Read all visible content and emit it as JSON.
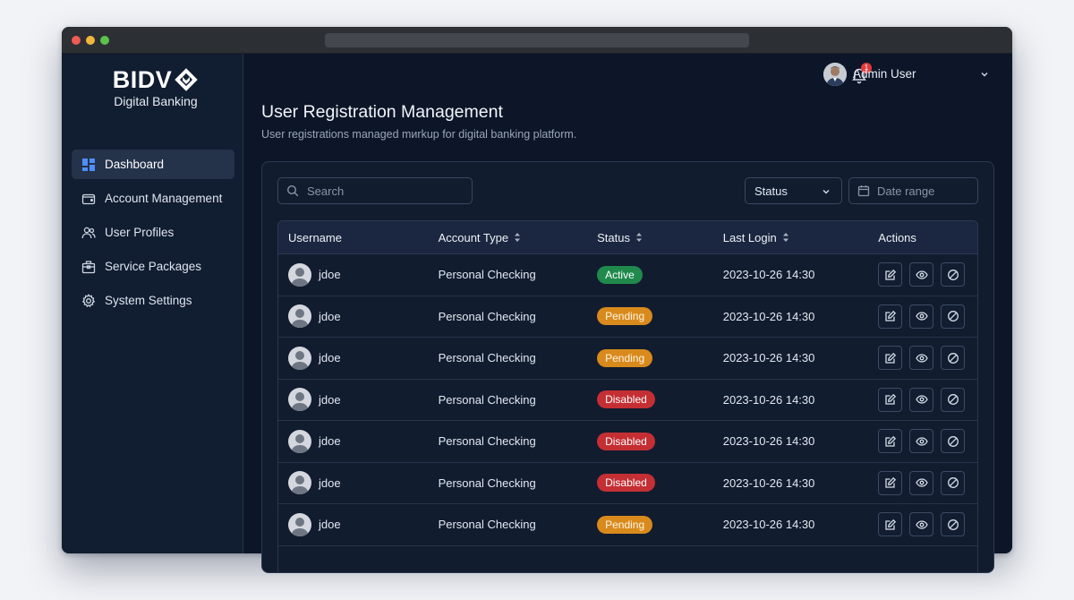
{
  "brand": {
    "name": "BIDV",
    "subtitle": "Digital Banking"
  },
  "sidebar": {
    "items": [
      {
        "label": "Dashboard",
        "icon": "dashboard-grid-icon",
        "active": true
      },
      {
        "label": "Account Management",
        "icon": "wallet-icon",
        "active": false
      },
      {
        "label": "User Profiles",
        "icon": "users-icon",
        "active": false
      },
      {
        "label": "Service Packages",
        "icon": "package-icon",
        "active": false
      },
      {
        "label": "System Settings",
        "icon": "gear-icon",
        "active": false
      }
    ]
  },
  "header": {
    "notification_count": "1",
    "user_name": "Admin User"
  },
  "page": {
    "title": "User Registration Management",
    "subtitle": "User registrations managed mиrkup for digital banking platform."
  },
  "filters": {
    "search_placeholder": "Search",
    "status_label": "Status",
    "date_placeholder": "Date range"
  },
  "table": {
    "columns": [
      "Username",
      "Account Type",
      "Status",
      "Last Login",
      "Actions"
    ],
    "rows": [
      {
        "username": "jdoe",
        "account_type": "Personal Checking",
        "status": "Active",
        "last_login": "2023-10-26 14:30"
      },
      {
        "username": "jdoe",
        "account_type": "Personal Checking",
        "status": "Pending",
        "last_login": "2023-10-26 14:30"
      },
      {
        "username": "jdoe",
        "account_type": "Personal Checking",
        "status": "Pending",
        "last_login": "2023-10-26 14:30"
      },
      {
        "username": "jdoe",
        "account_type": "Personal Checking",
        "status": "Disabled",
        "last_login": "2023-10-26 14:30"
      },
      {
        "username": "jdoe",
        "account_type": "Personal Checking",
        "status": "Disabled",
        "last_login": "2023-10-26 14:30"
      },
      {
        "username": "jdoe",
        "account_type": "Personal Checking",
        "status": "Disabled",
        "last_login": "2023-10-26 14:30"
      },
      {
        "username": "jdoe",
        "account_type": "Personal Checking",
        "status": "Pending",
        "last_login": "2023-10-26 14:30"
      }
    ]
  },
  "colors": {
    "active": "#1f8a4c",
    "pending": "#d98a1c",
    "disabled": "#c42f34",
    "accent": "#3b82f6"
  }
}
